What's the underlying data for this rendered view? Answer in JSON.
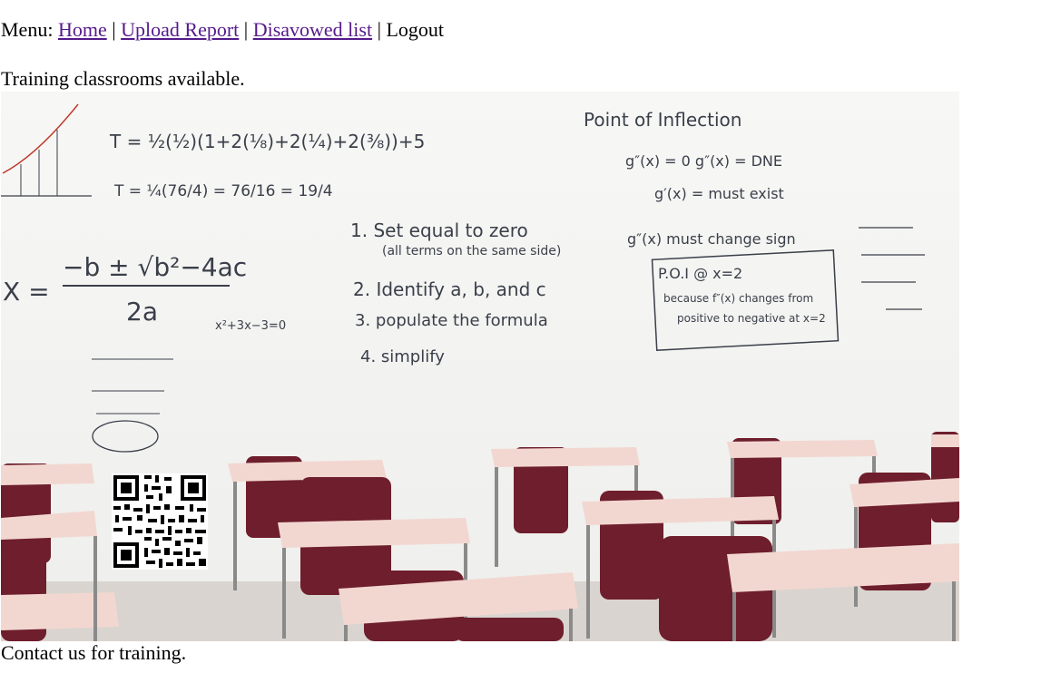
{
  "menu": {
    "prefix": "Menu:",
    "separator": "|",
    "links": [
      {
        "label": "Home"
      },
      {
        "label": "Upload Report"
      },
      {
        "label": "Disavowed list"
      }
    ],
    "logout": "Logout"
  },
  "intro": "Training classrooms available.",
  "image": {
    "board": {
      "heading": "Point of Inflection",
      "steps": [
        "1. Set equal to zero",
        "(all terms on the same side)",
        "2. Identify a, b, and c",
        "3. populate the formula",
        "4. simplify"
      ],
      "formula_left": "X =",
      "formula_top": "−b ± √b²−4ac",
      "formula_bottom": "2a",
      "calc_line": "x²+3x−3=0",
      "right_notes": [
        "g″(x) = 0   g″(x) = DNE",
        "g′(x) = must exist",
        "g″(x) must change sign",
        "P.O.I @ x=2",
        "because f″(x) changes from",
        "positive to negative at x=2"
      ],
      "top_notes": "T = ½(½)(1+2(⅛)+2(¼)+2(⅜))+5",
      "top_notes2": "T = ¼(76/4) = 76/16 = 19/4"
    }
  },
  "contact": "Contact us for training.",
  "colors": {
    "link": "#551a8b",
    "desk_top": "#f2d7d0",
    "chair": "#6e1e2c",
    "marker": "#3a3f4a"
  }
}
